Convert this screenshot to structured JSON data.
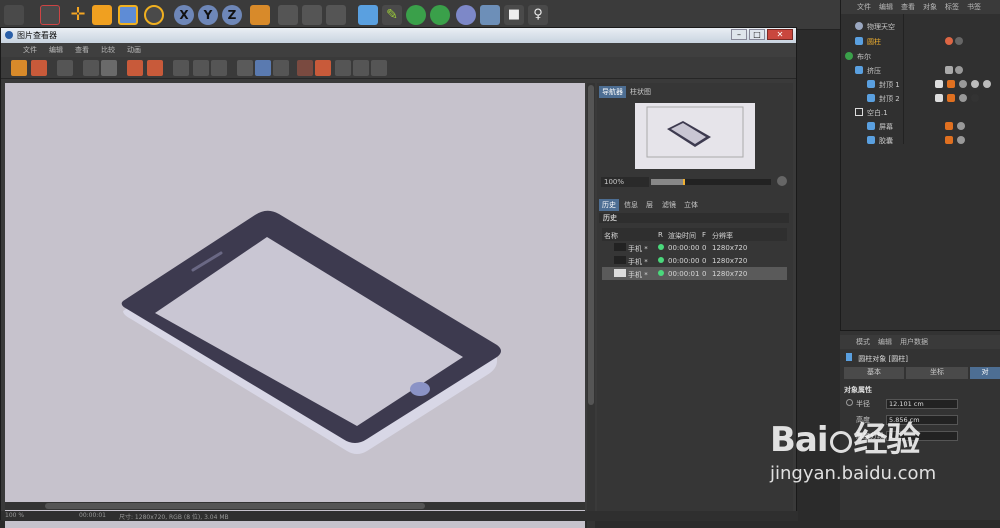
{
  "viewer": {
    "title": "图片查看器",
    "menu": [
      "文件",
      "编辑",
      "查看",
      "比较",
      "动画"
    ]
  },
  "side": {
    "tabs": [
      "导航器",
      "柱状图"
    ],
    "zoom": "100%",
    "info_tabs": [
      "历史",
      "信息",
      "层",
      "滤镜",
      "立体"
    ],
    "history_label": "历史",
    "columns": [
      "名称",
      "R",
      "渲染时间",
      "F",
      "分辨率"
    ],
    "rows": [
      {
        "name": "手机 *",
        "time": "00:00:00",
        "f": "0",
        "res": "1280x720"
      },
      {
        "name": "手机 *",
        "time": "00:00:00",
        "f": "0",
        "res": "1280x720"
      },
      {
        "name": "手机 *",
        "time": "00:00:01",
        "f": "0",
        "res": "1280x720"
      }
    ]
  },
  "status": {
    "zoom": "100 %",
    "time": "00:00:01",
    "info": "尺寸: 1280x720, RGB (8 位), 3.04 MB"
  },
  "object_manager": {
    "menu": [
      "文件",
      "编辑",
      "查看",
      "对象",
      "标签",
      "书签"
    ],
    "items": [
      {
        "name": "物理天空"
      },
      {
        "name": "圆柱"
      },
      {
        "name": "布尔"
      },
      {
        "name": "挤压"
      },
      {
        "name": "封顶 1"
      },
      {
        "name": "封顶 2"
      },
      {
        "name": "空白.1"
      },
      {
        "name": "屏幕"
      },
      {
        "name": "胶囊"
      }
    ]
  },
  "attributes": {
    "menu": [
      "模式",
      "编辑",
      "用户数据"
    ],
    "object_title": "圆柱对象 [圆柱]",
    "tabs": [
      "基本",
      "坐标",
      "对"
    ],
    "section": "对象属性",
    "fields": [
      {
        "label": "半径",
        "value": "12.101 cm"
      },
      {
        "label": "高度",
        "value": "5.856 cm"
      },
      {
        "label": "高度分段",
        "value": "1"
      }
    ]
  },
  "watermark": {
    "brand": "Bai",
    "brand2": "经验",
    "url": "jingyan.baidu.com"
  },
  "colors": {
    "phone_body": "#3d3a4f",
    "phone_screen": "#c9c6d3",
    "phone_side": "#d8d7e6",
    "home_button": "#8b93c6",
    "canvas_bg": "#c6c2cc",
    "accent": "#4d6e93"
  }
}
